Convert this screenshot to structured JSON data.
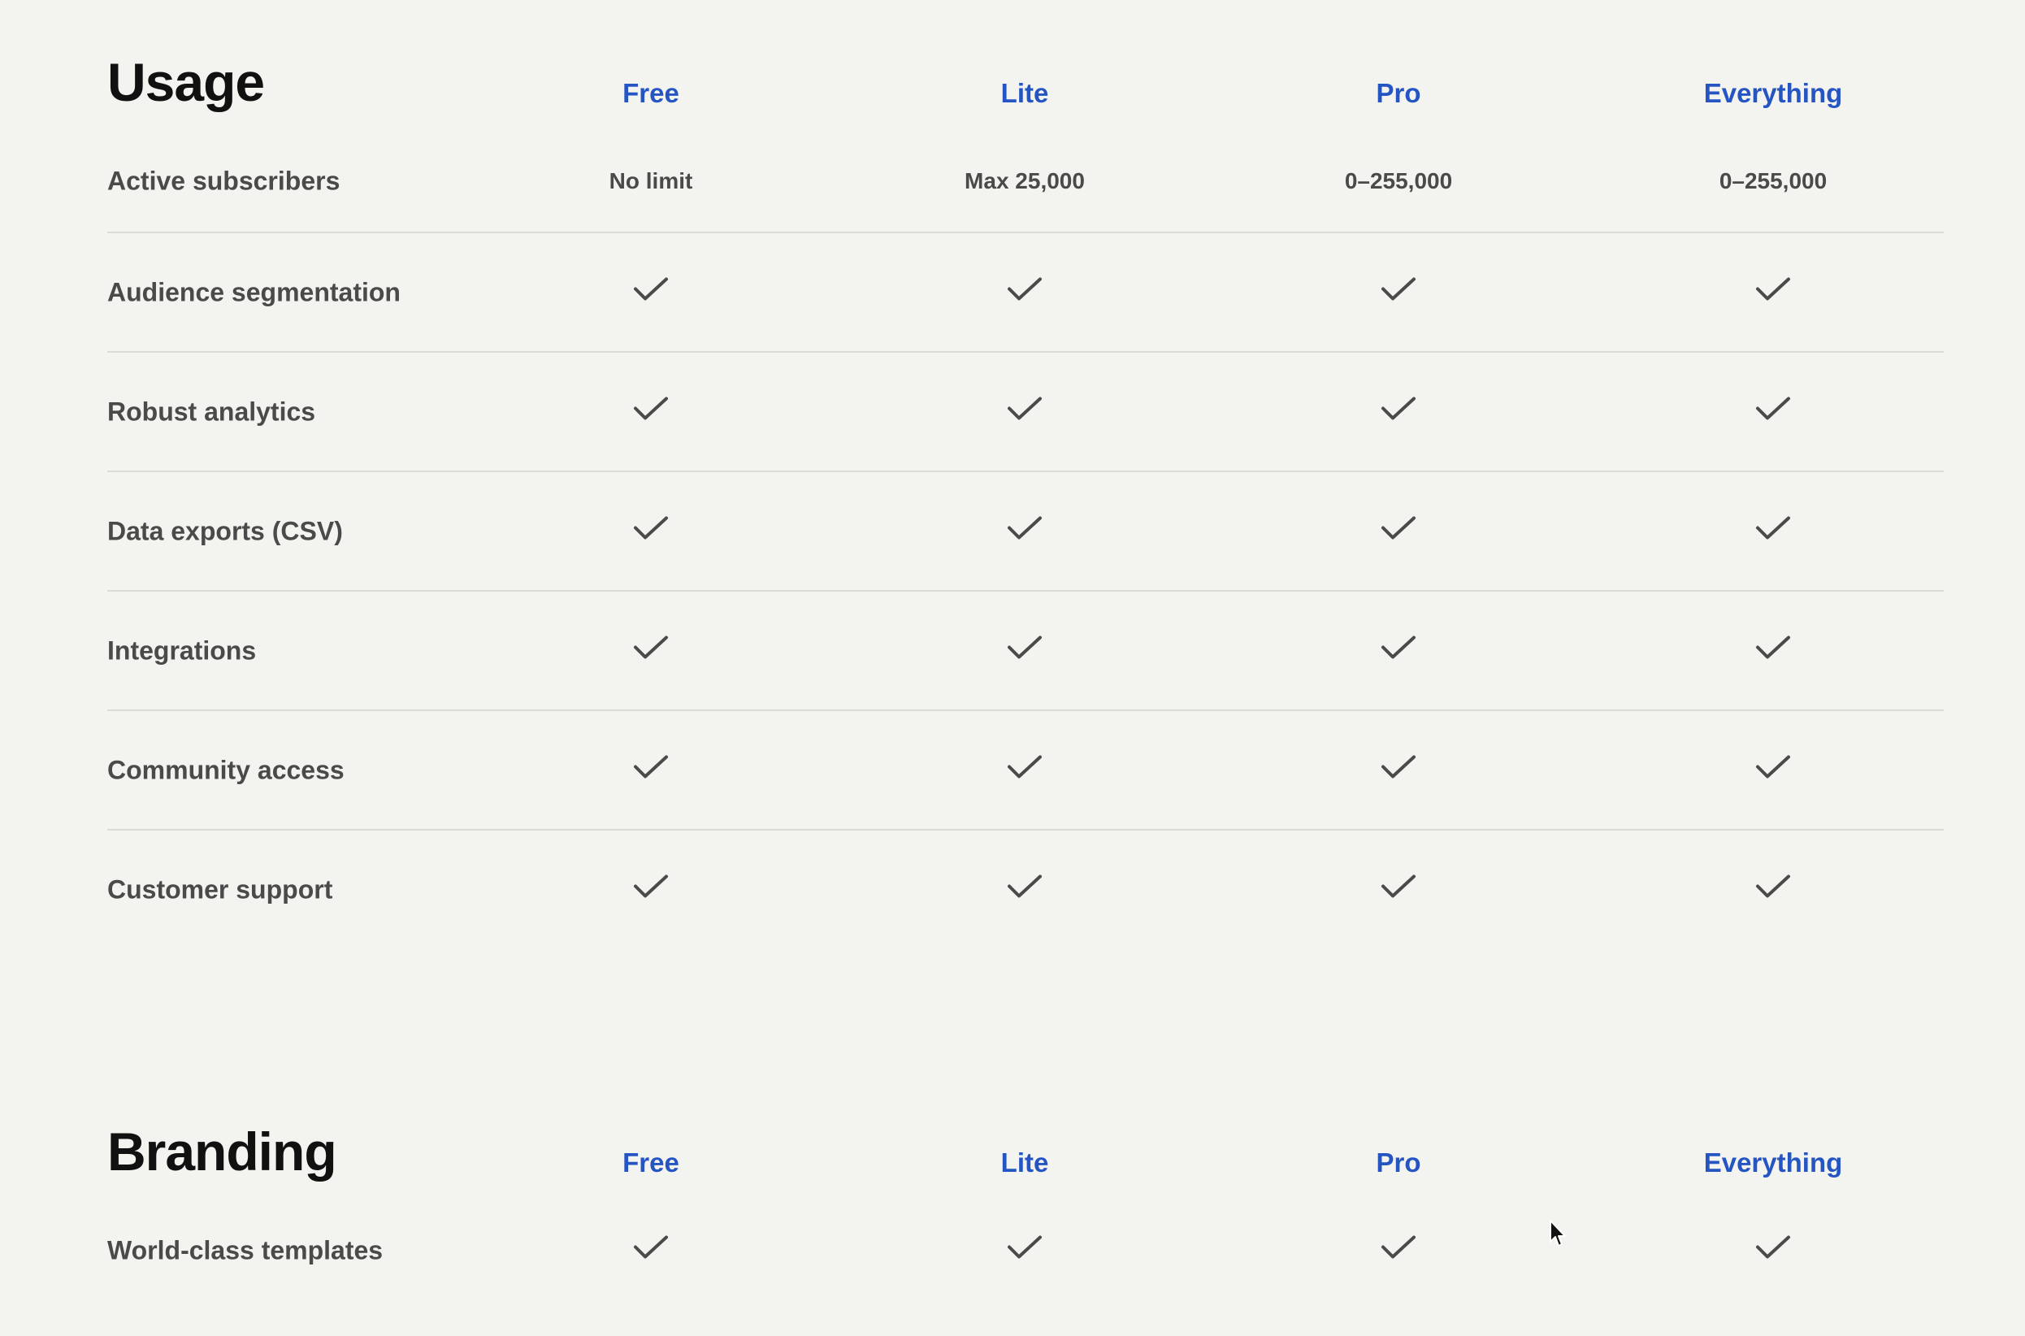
{
  "usage": {
    "title": "Usage",
    "plans": [
      "Free",
      "Lite",
      "Pro",
      "Everything"
    ],
    "rows": [
      {
        "feature": "Active subscribers",
        "values": [
          "No limit",
          "Max 25,000",
          "0–255,000",
          "0–255,000"
        ]
      },
      {
        "feature": "Audience segmentation",
        "values": [
          "check",
          "check",
          "check",
          "check"
        ]
      },
      {
        "feature": "Robust analytics",
        "values": [
          "check",
          "check",
          "check",
          "check"
        ]
      },
      {
        "feature": "Data exports (CSV)",
        "values": [
          "check",
          "check",
          "check",
          "check"
        ]
      },
      {
        "feature": "Integrations",
        "values": [
          "check",
          "check",
          "check",
          "check"
        ]
      },
      {
        "feature": "Community access",
        "values": [
          "check",
          "check",
          "check",
          "check"
        ]
      },
      {
        "feature": "Customer support",
        "values": [
          "check",
          "check",
          "check",
          "check"
        ]
      }
    ]
  },
  "branding": {
    "title": "Branding",
    "plans": [
      "Free",
      "Lite",
      "Pro",
      "Everything"
    ],
    "rows": [
      {
        "feature": "World-class templates",
        "values": [
          "check",
          "check",
          "check",
          "check"
        ]
      }
    ]
  },
  "icons": {
    "check": "checkmark-icon",
    "cursor": "mouse-pointer-icon"
  },
  "colors": {
    "background": "#f3f3ef",
    "plan_label": "#2455c3",
    "text": "#4a4a4a",
    "title": "#111111",
    "divider": "#dcdcd7"
  }
}
